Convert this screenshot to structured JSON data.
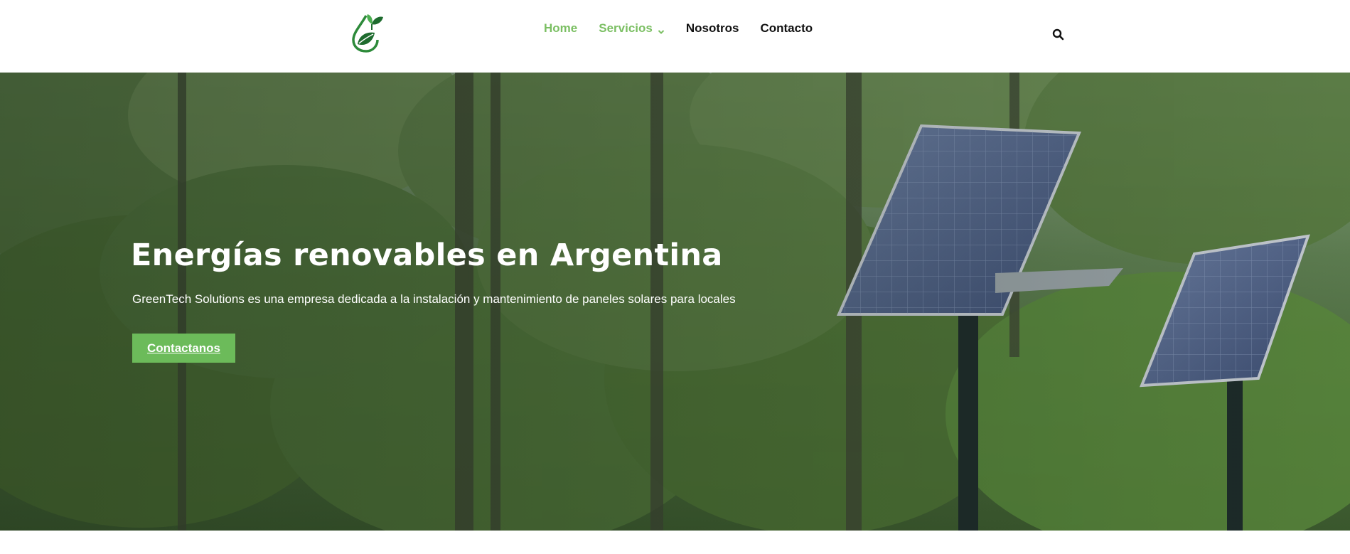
{
  "header": {
    "logo_icon": "leaf-drop-logo-icon",
    "nav": {
      "home": "Home",
      "servicios": "Servicios",
      "nosotros": "Nosotros",
      "contacto": "Contacto"
    },
    "search_icon": "search-icon"
  },
  "hero": {
    "title": "Energías renovables en Argentina",
    "subtitle": "GreenTech Solutions es una empresa dedicada a la instalación y mantenimiento de paneles solares para locales",
    "cta_label": "Contactanos"
  },
  "colors": {
    "accent": "#7bbf63",
    "button": "#6cbb5a",
    "nav_text": "#111111",
    "logo_dark": "#1e6b2e",
    "logo_light": "#4caf50"
  }
}
